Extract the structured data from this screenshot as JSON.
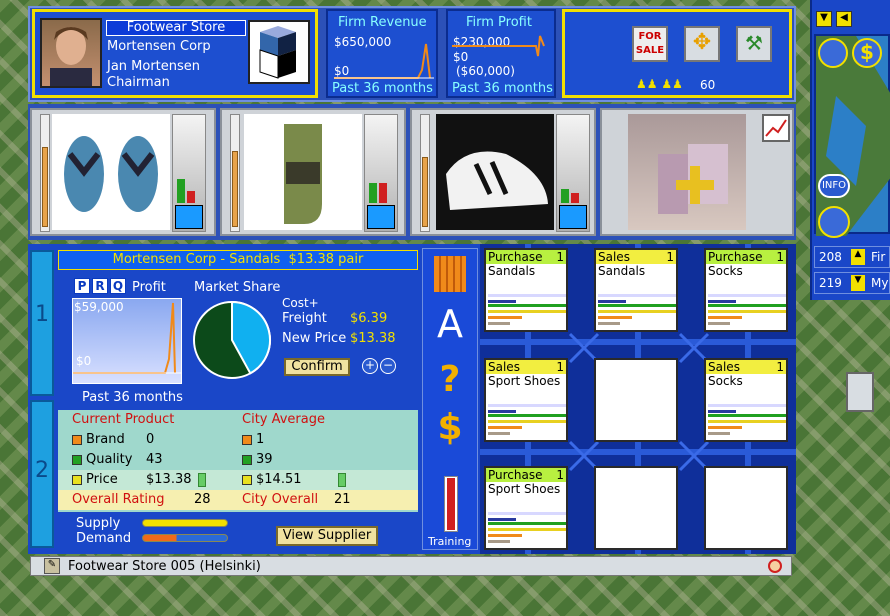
{
  "header": {
    "store_name": "Footwear Store",
    "company": "Mortensen Corp",
    "person": "Jan Mortensen",
    "title": "Chairman"
  },
  "revenue": {
    "title": "Firm Revenue",
    "value": "$650,000",
    "zero": "$0",
    "period": "Past 36 months"
  },
  "profit": {
    "title": "Firm Profit",
    "value": "$230,000",
    "zero": "$0",
    "neg": "($60,000)",
    "period": "Past 36 months"
  },
  "toolbar": {
    "count": "60",
    "for_sale": "FOR SALE"
  },
  "map_side": {
    "info": "INFO",
    "v1": "208",
    "v2": "219",
    "t1": "Fir",
    "t2": "My"
  },
  "product_header": "Mortensen Corp - Sandals  $13.38 pair",
  "tabs": {
    "p": "P",
    "r": "R",
    "q": "Q",
    "profit": "Profit",
    "market_share": "Market Share"
  },
  "profit_chart": {
    "top": "$59,000",
    "zero": "$0",
    "period": "Past 36 months"
  },
  "market_share": {
    "player": 0.42,
    "others": 0.58
  },
  "price": {
    "cost_label_1": "Cost+",
    "cost_label_2": "Freight",
    "cost_value": "$6.39",
    "new_price_label": "New Price",
    "new_price_value": "$13.38",
    "confirm": "Confirm"
  },
  "table": {
    "col1": "Current Product",
    "col2": "City Average",
    "rows": [
      {
        "label": "Brand",
        "value": "0",
        "avg": "1",
        "color": "#f08a1a"
      },
      {
        "label": "Quality",
        "value": "43",
        "avg": "39",
        "color": "#22a022"
      },
      {
        "label": "Price",
        "value": "$13.38",
        "avg": "$14.51",
        "color": "#e8e020"
      }
    ],
    "overall_label": "Overall Rating",
    "overall_value": "28",
    "city_overall_label": "City Overall",
    "city_overall_value": "21"
  },
  "supply": {
    "supply": "Supply",
    "demand": "Demand",
    "view_supplier": "View Supplier"
  },
  "training": "Training",
  "units": [
    {
      "type": "Purchase",
      "n": "1",
      "item": "Sandals"
    },
    {
      "type": "Sales",
      "n": "1",
      "item": "Sandals"
    },
    {
      "type": "Purchase",
      "n": "1",
      "item": "Socks"
    },
    {
      "type": "Sales",
      "n": "1",
      "item": "Sport Shoes"
    },
    {
      "type": "",
      "n": "",
      "item": ""
    },
    {
      "type": "Sales",
      "n": "1",
      "item": "Socks"
    },
    {
      "type": "Purchase",
      "n": "1",
      "item": "Sport Shoes"
    },
    {
      "type": "",
      "n": "",
      "item": ""
    },
    {
      "type": "",
      "n": "",
      "item": ""
    }
  ],
  "status": "Footwear Store 005 (Helsinki)",
  "side_tabs": {
    "t1": "1",
    "t2": "2"
  },
  "colors": {
    "panel": "#1a47c8",
    "accent": "#f2e000",
    "cyan": "#8ff"
  }
}
